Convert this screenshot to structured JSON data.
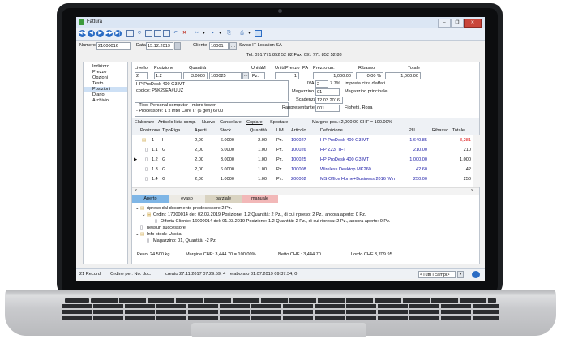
{
  "window": {
    "title": "Fattura",
    "controls": [
      "–",
      "❐",
      "✕"
    ]
  },
  "toolbar": {
    "nav_icons": [
      "◀◀",
      "◀",
      "▶",
      "▶▶",
      "▶|"
    ]
  },
  "header": {
    "number_label": "Numero",
    "number_value": "21000016",
    "date_label": "Data",
    "date_value": "15.12.2019",
    "client_label": "Cliente",
    "client_value": "10001",
    "client_name": "Swiss IT Location SA",
    "phone_line": "Tel. 091 771 852 52 82  Fax: 091 771 852 52 88"
  },
  "sidebar": {
    "items": [
      "Indirizzo",
      "Prezzo",
      "Opzioni",
      "Testo",
      "Posizioni",
      "Diario",
      "Archivio"
    ],
    "selected": "Posizioni"
  },
  "detail": {
    "col_livello": "Livello",
    "col_posizione": "Posizione",
    "col_quantita": "Quantità",
    "col_unitm": "UnitàM",
    "col_unitaprezzo": "UnitàPrezzo",
    "col_pa": "PA",
    "col_prezzo_un": "Prezzo un.",
    "col_ribasso": "Ribasso",
    "col_totale": "Totale",
    "livello": "2",
    "posizione": "1.2",
    "quantita": "3.0000",
    "article": "100025",
    "unit": "Pz.",
    "unitaprezzo": "1",
    "prezzo": "1,000.00",
    "ribasso": "0.00 %",
    "totale": "1,000.00",
    "description": "HP ProDesk 400 G3 MT",
    "code": "codice: P5K29EA#UUZ",
    "iva_label": "IVA",
    "iva_value": "2",
    "iva_rate": "7.7%",
    "iva_text": "Imposta cifra d'affari ...",
    "magazzino_label": "Magazzino",
    "magazzino_value": "01",
    "magazzino_text": "Magazzino principale",
    "scadenza_label": "Scadenza",
    "scadenza_value": "12.03.2016",
    "rappresentante_label": "Rappresentante",
    "rappresentante_value": "001",
    "rappresentante_text": "Fighetti, Rosa",
    "notes": [
      "- Tipo: Personal computer - micro tower",
      "- Processore: 1 x Intel Core i7 (6 gen) 6700"
    ]
  },
  "actions": {
    "elaborate": "Elaborare - Articolo lista comp.",
    "new": "Nuovo",
    "delete": "Cancellare",
    "copy": "Copiare",
    "move": "Spostare",
    "margin": "Margine pos.: 2,000.00 CHF = 100.00%"
  },
  "grid": {
    "headers": [
      "Posizione",
      "TipoRiga",
      "Aperti",
      "Stock",
      "Quantità",
      "UM",
      "Articolo",
      "Definizione",
      "PU",
      "Ribasso",
      "Totale"
    ],
    "rows": [
      {
        "pos": "1",
        "tipo": "H",
        "aperti": "2,00",
        "stock": "6.0000",
        "qta": "2.00",
        "um": "Pz.",
        "art": "100027",
        "def": "HP ProDesk 400 G3 MT",
        "pu": "1,640.85",
        "rib": "",
        "tot": "3,281"
      },
      {
        "pos": "1.1",
        "tipo": "G",
        "aperti": "2,00",
        "stock": "5.0000",
        "qta": "1.00",
        "um": "Pz.",
        "art": "100026",
        "def": "HP Z23i TFT",
        "pu": "210.00",
        "rib": "",
        "tot": "210"
      },
      {
        "pos": "1.2",
        "tipo": "G",
        "aperti": "2,00",
        "stock": "3.0000",
        "qta": "1.00",
        "um": "Pz.",
        "art": "100025",
        "def": "HP ProDesk 400 G3 MT",
        "pu": "1,000.00",
        "rib": "",
        "tot": "1,000"
      },
      {
        "pos": "1.3",
        "tipo": "G",
        "aperti": "2,00",
        "stock": "6.0000",
        "qta": "1.00",
        "um": "Pz.",
        "art": "100008",
        "def": "Wireless Desktop MK260",
        "pu": "42.60",
        "rib": "",
        "tot": "42"
      },
      {
        "pos": "1.4",
        "tipo": "G",
        "aperti": "2,00",
        "stock": "1.0000",
        "qta": "1.00",
        "um": "Pz.",
        "art": "200002",
        "def": "MS Office Home+Business 2016 Win",
        "pu": "250.00",
        "rib": "",
        "tot": "250"
      }
    ],
    "current_row": 2
  },
  "status_tabs": [
    {
      "label": "Aperto",
      "color": "#7fb6e6"
    },
    {
      "label": "evaso",
      "color": "#eceae4"
    },
    {
      "label": "parziale",
      "color": "#d9d3c1"
    },
    {
      "label": "manuale",
      "color": "#f2b8b8"
    }
  ],
  "tree": [
    "ripreso dal documento predecessore 2 Pz.",
    "Ordini: 17000014 del: 02.03.2019 Posizione: 1.2 Quantità: 2 Pz., di cui ripreso: 2 Pz., ancora aperto: 0 Pz.",
    "Offerta Cliente: 16000014 del: 01.03.2019 Posizione: 1.2 Quantità: 2 Pz., di cui ripresa: 2 Pz., ancora aperto: 0 Pz.",
    "nessun successore",
    "Info stock: Uscita",
    "Magazzino: 01, Quantità: -2 Pz."
  ],
  "summary": {
    "weight": "Peso:  24.500 kg",
    "margin": "Margine CHF: 3,444.70 = 100,00%",
    "net": "Netto CHF : 3,444.70",
    "gross": "Lordo CHF 3,709.95"
  },
  "statusbar": {
    "records": "21 Record",
    "order": "Ordine per: No. doc.",
    "created": "creato 27.11.2017 07:29:59, 4",
    "edited": "elaborato 31.07.2019 09:37:34, 0",
    "filter": "<Tutti i campi>"
  },
  "colors": {
    "accent": "#2b6cc4",
    "title_bar": "#dbe6f4",
    "grid_link": "#1a1aa6"
  }
}
